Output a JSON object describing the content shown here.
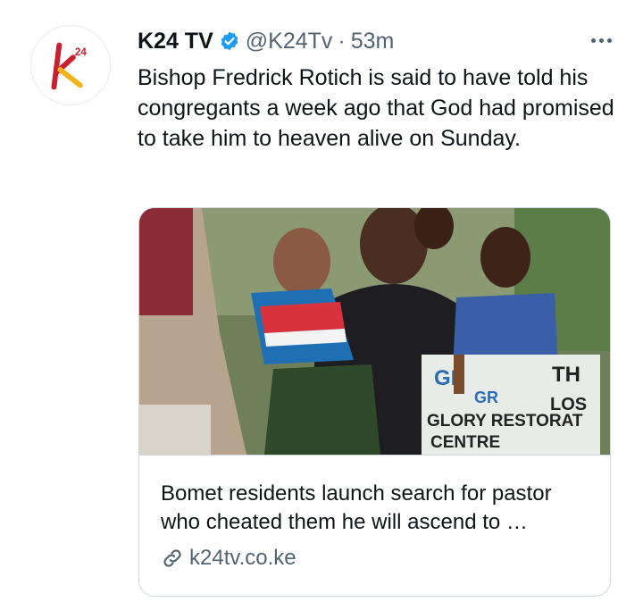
{
  "tweet": {
    "author": {
      "display_name": "K24 TV",
      "handle": "@K24Tv",
      "verified": true,
      "avatar_logo_text": "k24"
    },
    "dot": "·",
    "time": "53m",
    "text": "Bishop Fredrick Rotich is said to have told his congregants a week ago that God had promised to take him to heaven alive on Sunday.",
    "more_icon": "more-horizontal-icon",
    "card": {
      "image_sign_text": "GLORY RESTORATION CENTRE",
      "title": "Bomet residents launch search for pastor who cheated them he will ascend to …",
      "link_icon": "link-icon",
      "domain": "k24tv.co.ke"
    }
  },
  "colors": {
    "text_primary": "#0f1419",
    "text_secondary": "#536471",
    "verified_blue": "#1d9bf0",
    "border": "#cfd9de",
    "logo_red": "#c8202f",
    "logo_yellow": "#f3b21a"
  }
}
